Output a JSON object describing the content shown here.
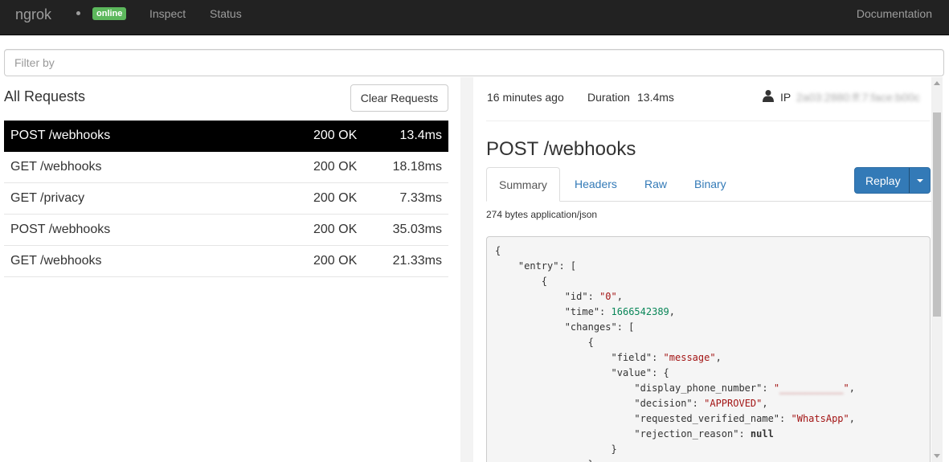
{
  "navbar": {
    "brand": "ngrok",
    "status_badge": "online",
    "links": {
      "inspect": "Inspect",
      "status": "Status",
      "documentation": "Documentation"
    }
  },
  "filter": {
    "placeholder": "Filter by",
    "value": ""
  },
  "requests_panel": {
    "title": "All Requests",
    "clear_button": "Clear Requests",
    "rows": [
      {
        "path": "POST /webhooks",
        "status": "200 OK",
        "duration": "13.4ms",
        "selected": true
      },
      {
        "path": "GET /webhooks",
        "status": "200 OK",
        "duration": "18.18ms",
        "selected": false
      },
      {
        "path": "GET /privacy",
        "status": "200 OK",
        "duration": "7.33ms",
        "selected": false
      },
      {
        "path": "POST /webhooks",
        "status": "200 OK",
        "duration": "35.03ms",
        "selected": false
      },
      {
        "path": "GET /webhooks",
        "status": "200 OK",
        "duration": "21.33ms",
        "selected": false
      }
    ]
  },
  "detail": {
    "time_ago": "16 minutes ago",
    "duration_label": "Duration",
    "duration": "13.4ms",
    "ip_label": "IP",
    "ip_value": "2a03:2880:ff:7:face:b00c",
    "title": "POST /webhooks",
    "tabs": [
      "Summary",
      "Headers",
      "Raw",
      "Binary"
    ],
    "replay_button": "Replay",
    "body_info": "274 bytes application/json",
    "json": {
      "entry": "entry",
      "id": "id",
      "id_val": "0",
      "time": "time",
      "time_val": "1666542389",
      "changes": "changes",
      "field": "field",
      "field_val": "message",
      "value": "value",
      "display_phone_number": "display_phone_number",
      "display_phone_number_val": "___________",
      "decision": "decision",
      "decision_val": "APPROVED",
      "requested_verified_name": "requested_verified_name",
      "requested_verified_name_val": "WhatsApp",
      "rejection_reason": "rejection_reason",
      "rejection_reason_val": "null"
    }
  },
  "colors": {
    "navbar": "#222222",
    "online": "#5cb85c",
    "selected_row": "#000000",
    "link": "#337ab7",
    "primary_button": "#337ab7"
  },
  "icons": {
    "user": "user-icon",
    "caret": "caret-down-icon"
  }
}
